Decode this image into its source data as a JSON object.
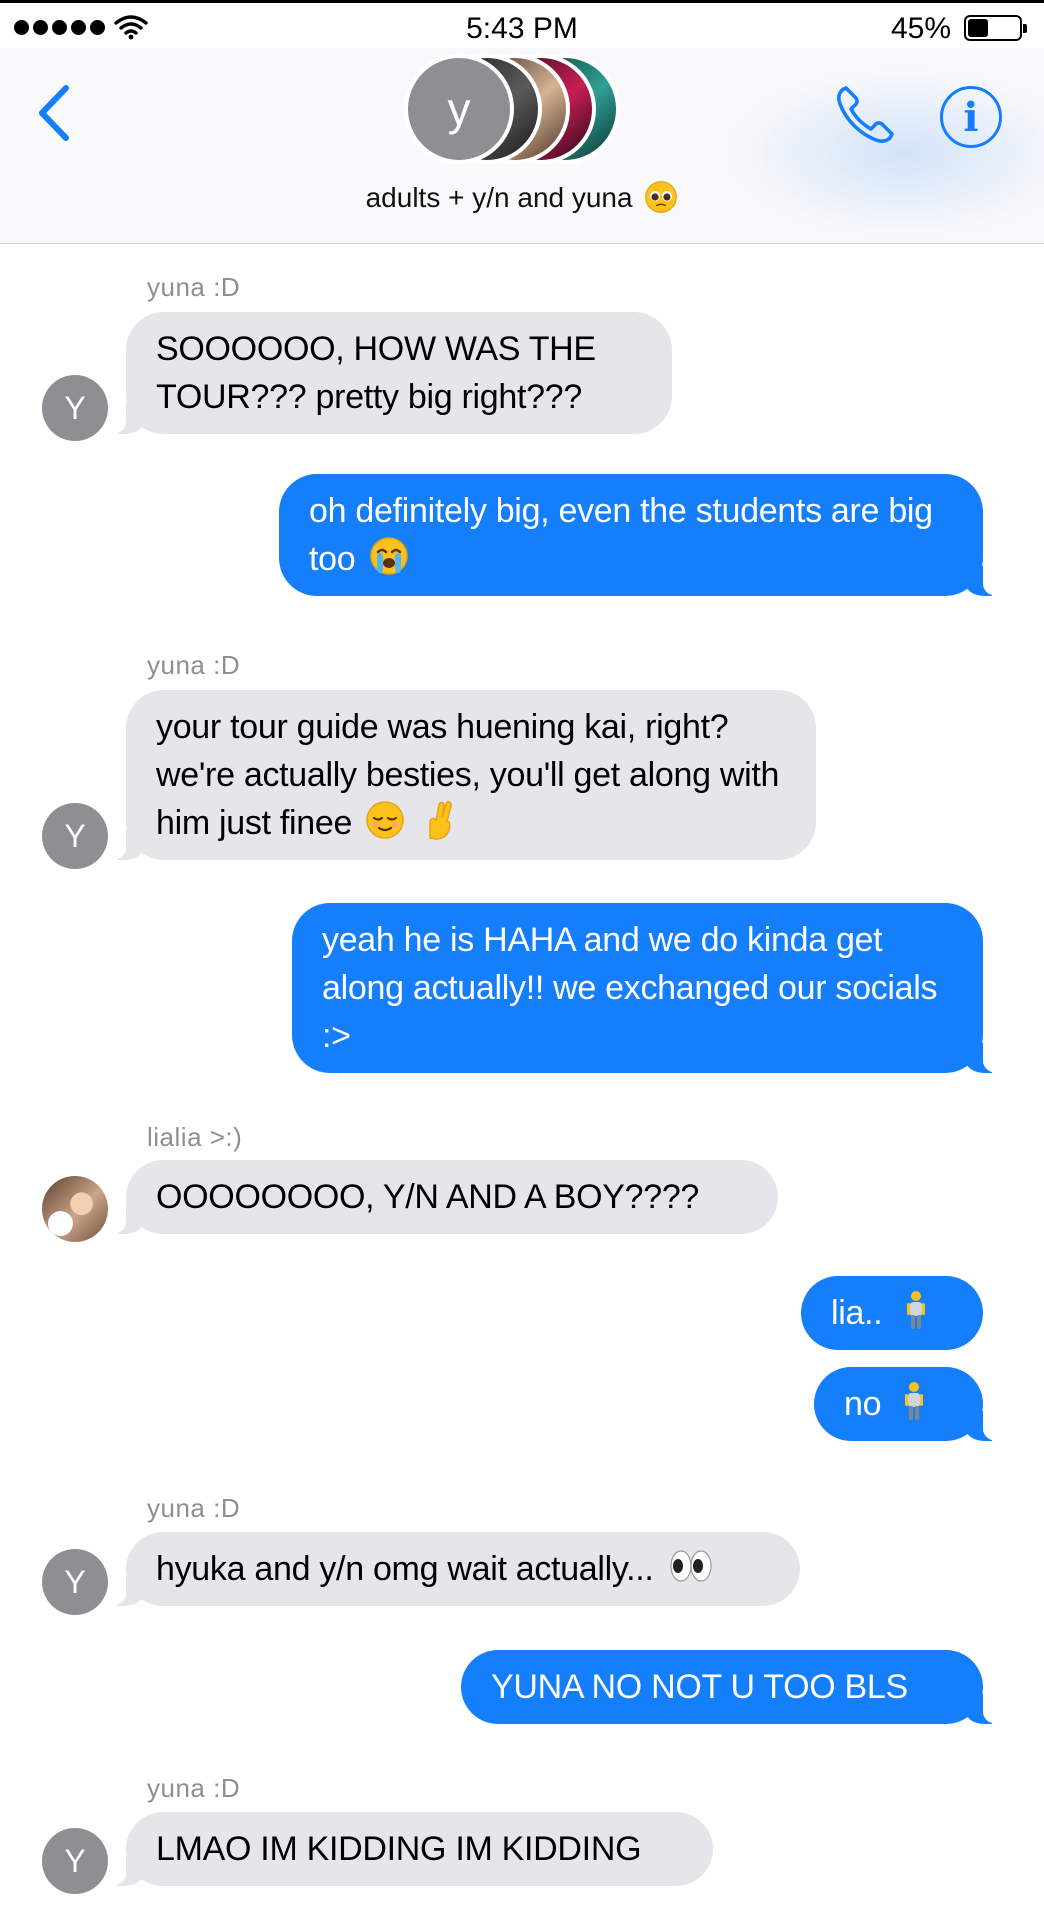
{
  "status_bar": {
    "time": "5:43 PM",
    "battery_percent": "45%",
    "battery_level": 0.45,
    "signal_dots": 5
  },
  "header": {
    "avatar_letter": "y",
    "group_title": "adults + y/n and yuna",
    "title_emoji": "pleading-face-emoji",
    "back_icon": "chevron-left-icon",
    "call_icon": "phone-icon",
    "info_icon": "info-icon",
    "accent_color": "#147efb"
  },
  "messages": [
    {
      "sender": "yuna :D",
      "avatar": "Y",
      "direction": "incoming",
      "text": "SOOOOOO, HOW WAS THE TOUR??? pretty big right???"
    },
    {
      "direction": "outgoing",
      "text": "oh definitely big, even the students are big too",
      "emoji": "loudly-crying-face-emoji"
    },
    {
      "sender": "yuna :D",
      "avatar": "Y",
      "direction": "incoming",
      "text": "your tour guide was huening kai, right? we're actually besties, you'll get along with him just finee",
      "emoji": "relieved-face-and-crossed-fingers-emoji"
    },
    {
      "direction": "outgoing",
      "text": "yeah he is HAHA and we do kinda get along actually!! we exchanged our socials :>"
    },
    {
      "sender": "lialia >:)",
      "avatar": "photo",
      "direction": "incoming",
      "text": "OOOOOOOO, Y/N AND A BOY????"
    },
    {
      "direction": "outgoing",
      "text": "lia..",
      "emoji": "standing-person-emoji"
    },
    {
      "direction": "outgoing",
      "text": "no",
      "emoji": "standing-person-emoji"
    },
    {
      "sender": "yuna :D",
      "avatar": "Y",
      "direction": "incoming",
      "text": "hyuka and y/n omg wait actually...",
      "emoji": "eyes-emoji"
    },
    {
      "direction": "outgoing",
      "text": "YUNA NO NOT U TOO BLS"
    },
    {
      "sender": "yuna :D",
      "avatar": "Y",
      "direction": "incoming",
      "text": "LMAO IM KIDDING IM KIDDING"
    }
  ],
  "colors": {
    "outgoing_bubble": "#147efb",
    "incoming_bubble": "#e5e5ea",
    "sender_label": "#8e8e93",
    "avatar_gray": "#8e8e93"
  }
}
